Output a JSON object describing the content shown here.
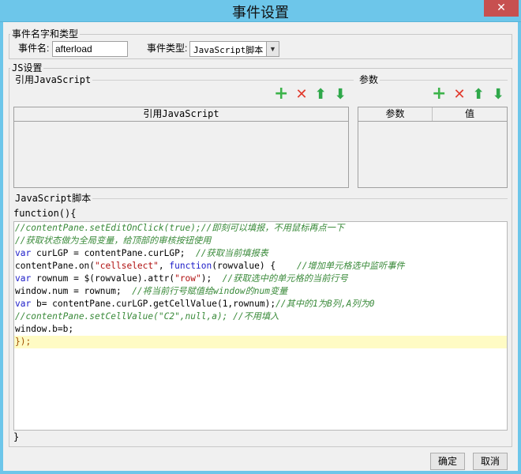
{
  "window": {
    "title": "事件设置",
    "close_symbol": "✕"
  },
  "event_group": {
    "legend": "事件名字和类型",
    "name_label": "事件名:",
    "name_value": "afterload",
    "type_label": "事件类型:",
    "type_value": "JavaScript脚本"
  },
  "js_group": {
    "legend": "JS设置",
    "ref_js_legend": "引用JavaScript",
    "params_legend": "参数",
    "ref_table_header": "引用JavaScript",
    "params_table_headers": [
      "参数",
      "值"
    ],
    "toolbar": {
      "add": "+",
      "delete": "✕",
      "up": "⬆",
      "down": "⬇"
    }
  },
  "script_group": {
    "legend": "JavaScript脚本",
    "func_open": "function(){",
    "func_close": "}",
    "lines": [
      [
        {
          "t": "//contentPane.setEditOnClick(true);//即刻可以填报，不用鼠标再点一下",
          "c": "comment"
        }
      ],
      [
        {
          "t": "//获取状态做为全局变量，给顶部的审核按钮使用",
          "c": "comment"
        }
      ],
      [
        {
          "t": "var",
          "c": "kw"
        },
        {
          "t": " curLGP = contentPane.curLGP;  ",
          "c": "plain"
        },
        {
          "t": "//获取当前填报表",
          "c": "comment"
        }
      ],
      [
        {
          "t": "contentPane.on(",
          "c": "plain"
        },
        {
          "t": "\"cellselect\"",
          "c": "str"
        },
        {
          "t": ", ",
          "c": "plain"
        },
        {
          "t": "function",
          "c": "kw"
        },
        {
          "t": "(rowvalue) {    ",
          "c": "plain"
        },
        {
          "t": "//增加单元格选中监听事件",
          "c": "comment"
        }
      ],
      [
        {
          "t": "var",
          "c": "kw"
        },
        {
          "t": " rownum = $(rowvalue).attr(",
          "c": "plain"
        },
        {
          "t": "\"row\"",
          "c": "str"
        },
        {
          "t": ");  ",
          "c": "plain"
        },
        {
          "t": "//获取选中的单元格的当前行号",
          "c": "comment"
        }
      ],
      [
        {
          "t": "window.num = rownum;  ",
          "c": "plain"
        },
        {
          "t": "//将当前行号赋值给window的num变量",
          "c": "comment"
        }
      ],
      [
        {
          "t": "var",
          "c": "kw"
        },
        {
          "t": " b= contentPane.curLGP.getCellValue(1,rownum);",
          "c": "plain"
        },
        {
          "t": "//其中的1为B列,A列为0",
          "c": "comment"
        }
      ],
      [
        {
          "t": "//contentPane.setCellValue(\"C2\",null,a); //不用填入",
          "c": "comment"
        }
      ],
      [
        {
          "t": "window.b=b;",
          "c": "plain"
        }
      ],
      [
        {
          "t": "});",
          "c": "paren"
        }
      ]
    ]
  },
  "footer": {
    "ok_label": "确定",
    "cancel_label": "取消"
  }
}
